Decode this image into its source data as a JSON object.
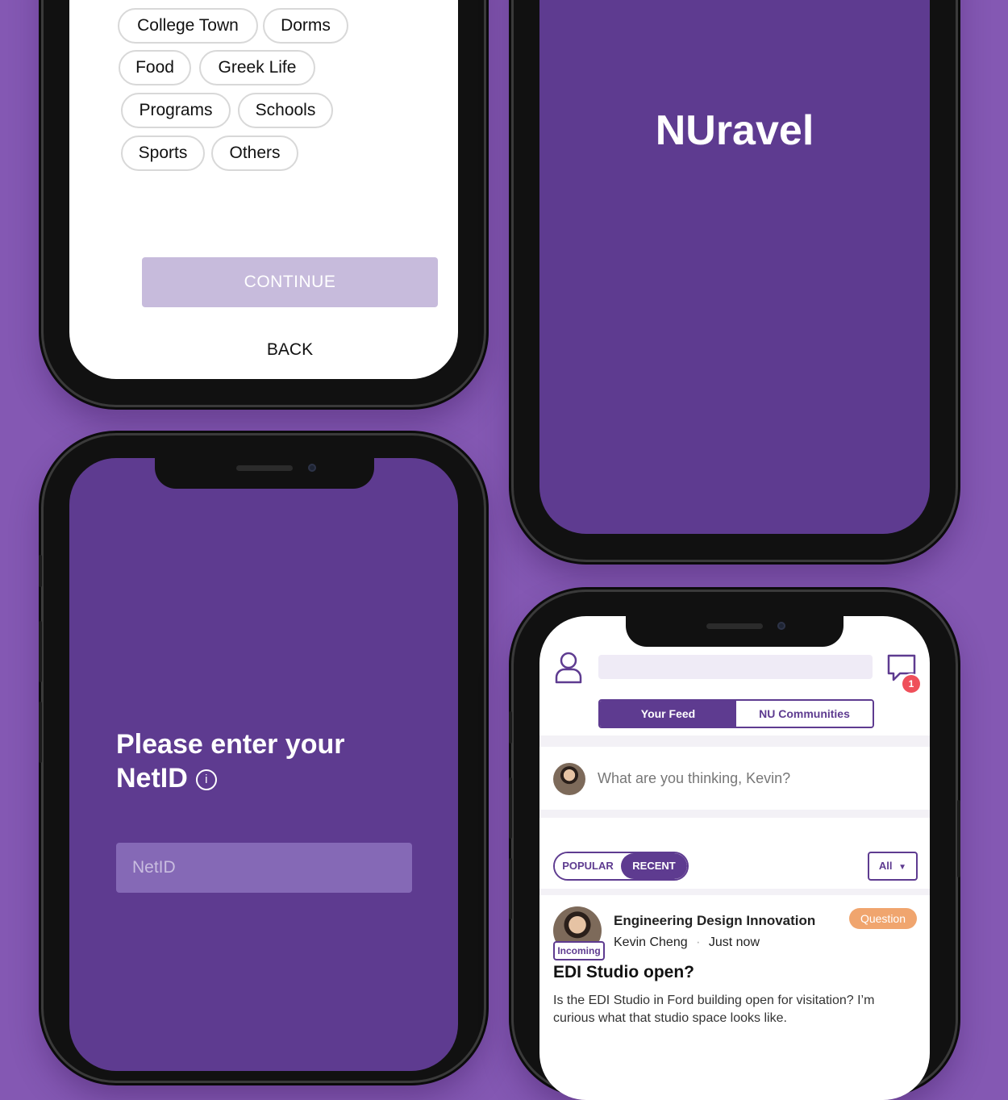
{
  "colors": {
    "background": "#8458b3",
    "brand_purple": "#5e3b90",
    "continue_disabled": "#c7bbdc",
    "question_badge": "#f0a56e",
    "notification": "#ef4f5a"
  },
  "interests": {
    "chips": [
      "College Town",
      "Dorms",
      "Food",
      "Greek Life",
      "Programs",
      "Schools",
      "Sports",
      "Others"
    ],
    "continue_label": "CONTINUE",
    "back_label": "BACK"
  },
  "splash": {
    "brand": "NUravel"
  },
  "login": {
    "prompt_line1": "Please enter your",
    "prompt_line2": "NetID",
    "info_icon": "i",
    "netid_placeholder": "NetID"
  },
  "feed": {
    "profile_icon": "user-icon",
    "chat_icon": "chat-bubble-icon",
    "notification_count": "1",
    "tabs": [
      "Your Feed",
      "NU Communities"
    ],
    "composer_placeholder": "What are you thinking, Kevin?",
    "sort": [
      "POPULAR",
      "RECENT"
    ],
    "filter_value": "All",
    "post": {
      "community": "Engineering Design Innovation",
      "author": "Kevin Cheng",
      "separator": "·",
      "time": "Just now",
      "badge": "Question",
      "author_tag": "Incoming",
      "title": "EDI Studio open?",
      "body": "Is the EDI Studio in Ford building open for visitation? I’m curious what that studio space looks like."
    }
  }
}
